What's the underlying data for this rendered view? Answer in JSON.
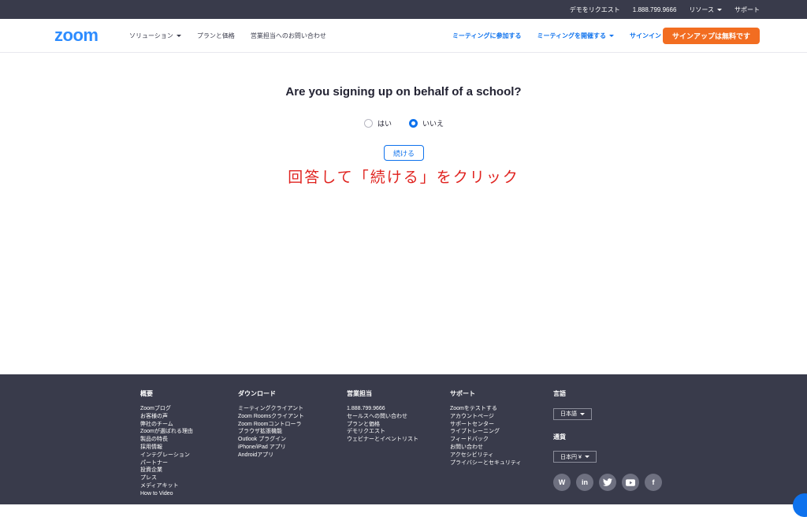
{
  "topbar": {
    "demo": "デモをリクエスト",
    "phone": "1.888.799.9666",
    "resources": "リソース",
    "support": "サポート"
  },
  "navbar": {
    "logo": "zoom",
    "solutions": "ソリューション",
    "plans": "プランと価格",
    "contact_sales": "営業担当へのお問い合わせ",
    "join": "ミーティングに参加する",
    "host": "ミーティングを開催する",
    "signin": "サインイン",
    "signup": "サインアップは無料です"
  },
  "main": {
    "question": "Are you signing up on behalf of a school?",
    "option_yes": "はい",
    "option_no": "いいえ",
    "selected": "いいえ",
    "continue": "続ける",
    "instruction": "回答して「続ける」をクリック"
  },
  "footer": {
    "about": {
      "title": "概要",
      "items": [
        "Zoomブログ",
        "お客様の声",
        "弊社のチーム",
        "Zoomが選ばれる理由",
        "製品の特長",
        "採用情報",
        "インテグレーション",
        "パートナー",
        "投資企業",
        "プレス",
        "メディアキット",
        "How to Video"
      ]
    },
    "download": {
      "title": "ダウンロード",
      "items": [
        "ミーティングクライアント",
        "Zoom Roomsクライアント",
        "Zoom Roomコントローラ",
        "ブラウザ拡張機能",
        "Outlook プラグイン",
        "iPhone/iPad アプリ",
        "Androidアプリ"
      ]
    },
    "sales": {
      "title": "営業担当",
      "items": [
        "1.888.799.9666",
        "セールスへの問い合わせ",
        "プランと価格",
        "デモリクエスト",
        "ウェビナーとイベントリスト"
      ]
    },
    "support": {
      "title": "サポート",
      "items": [
        "Zoomをテストする",
        "アカウントページ",
        "サポートセンター",
        "ライブトレーニング",
        "フィードバック",
        "お問い合わせ",
        "アクセシビリティ",
        "プライバシーとセキュリティ"
      ]
    },
    "language": {
      "title": "言語",
      "value": "日本語"
    },
    "currency": {
      "title": "通貨",
      "value": "日本円 ¥"
    },
    "social": [
      "wordpress-icon",
      "linkedin-icon",
      "twitter-icon",
      "youtube-icon",
      "facebook-icon"
    ]
  },
  "colors": {
    "brand_blue": "#2d8cff",
    "link_blue": "#0e72ed",
    "signup_orange": "#f26d21",
    "instruction_red": "#e0231f",
    "dark_bar": "#393b4b"
  }
}
